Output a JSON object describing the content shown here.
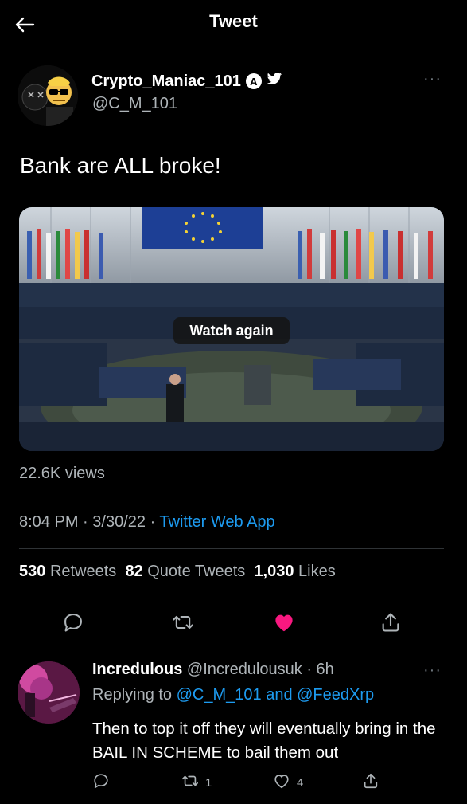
{
  "header": {
    "title": "Tweet"
  },
  "tweet": {
    "author_name": "Crypto_Maniac_101",
    "author_badge": "A",
    "author_handle": "@C_M_101",
    "more": "···",
    "text": "Bank are ALL broke!",
    "media_label": "Watch again",
    "views": "22.6K views",
    "time": "8:04 PM",
    "date": "3/30/22",
    "app": "Twitter Web App",
    "retweets_count": "530",
    "retweets_label": "Retweets",
    "quotes_count": "82",
    "quotes_label": "Quote Tweets",
    "likes_count": "1,030",
    "likes_label": "Likes",
    "liked": true
  },
  "reply": {
    "name": "Incredulous",
    "handle": "@Incredulousuk",
    "time": "6h",
    "more": "···",
    "replying_prefix": "Replying to",
    "replying_targets": "@C_M_101 and @FeedXrp",
    "text": "Then to top it off they will eventually bring in the BAIL IN SCHEME to bail them out",
    "retweet_count": "1",
    "like_count": "4"
  },
  "colors": {
    "accent": "#1d9bf0",
    "like": "#f91880",
    "background": "#000000",
    "secondary_text": "#aeb4b8"
  }
}
